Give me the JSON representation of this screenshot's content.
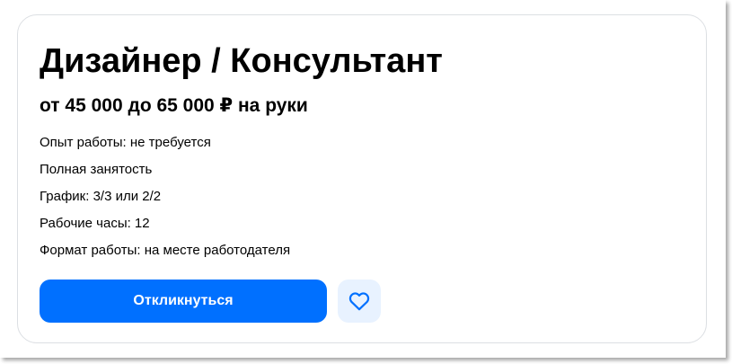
{
  "vacancy": {
    "title": "Дизайнер / Консультант",
    "salary": "от 45 000 до 65 000 ₽ на руки",
    "details": [
      "Опыт работы: не требуется",
      "Полная занятость",
      "График: 3/3 или 2/2",
      "Рабочие часы: 12",
      "Формат работы: на месте работодателя"
    ]
  },
  "actions": {
    "respond_label": "Откликнуться",
    "favorite_icon": "heart-icon"
  },
  "colors": {
    "primary_button": "#0070ff",
    "favorite_bg": "#e8f2ff",
    "heart_stroke": "#0070ff",
    "card_border": "#dcdfe3"
  }
}
